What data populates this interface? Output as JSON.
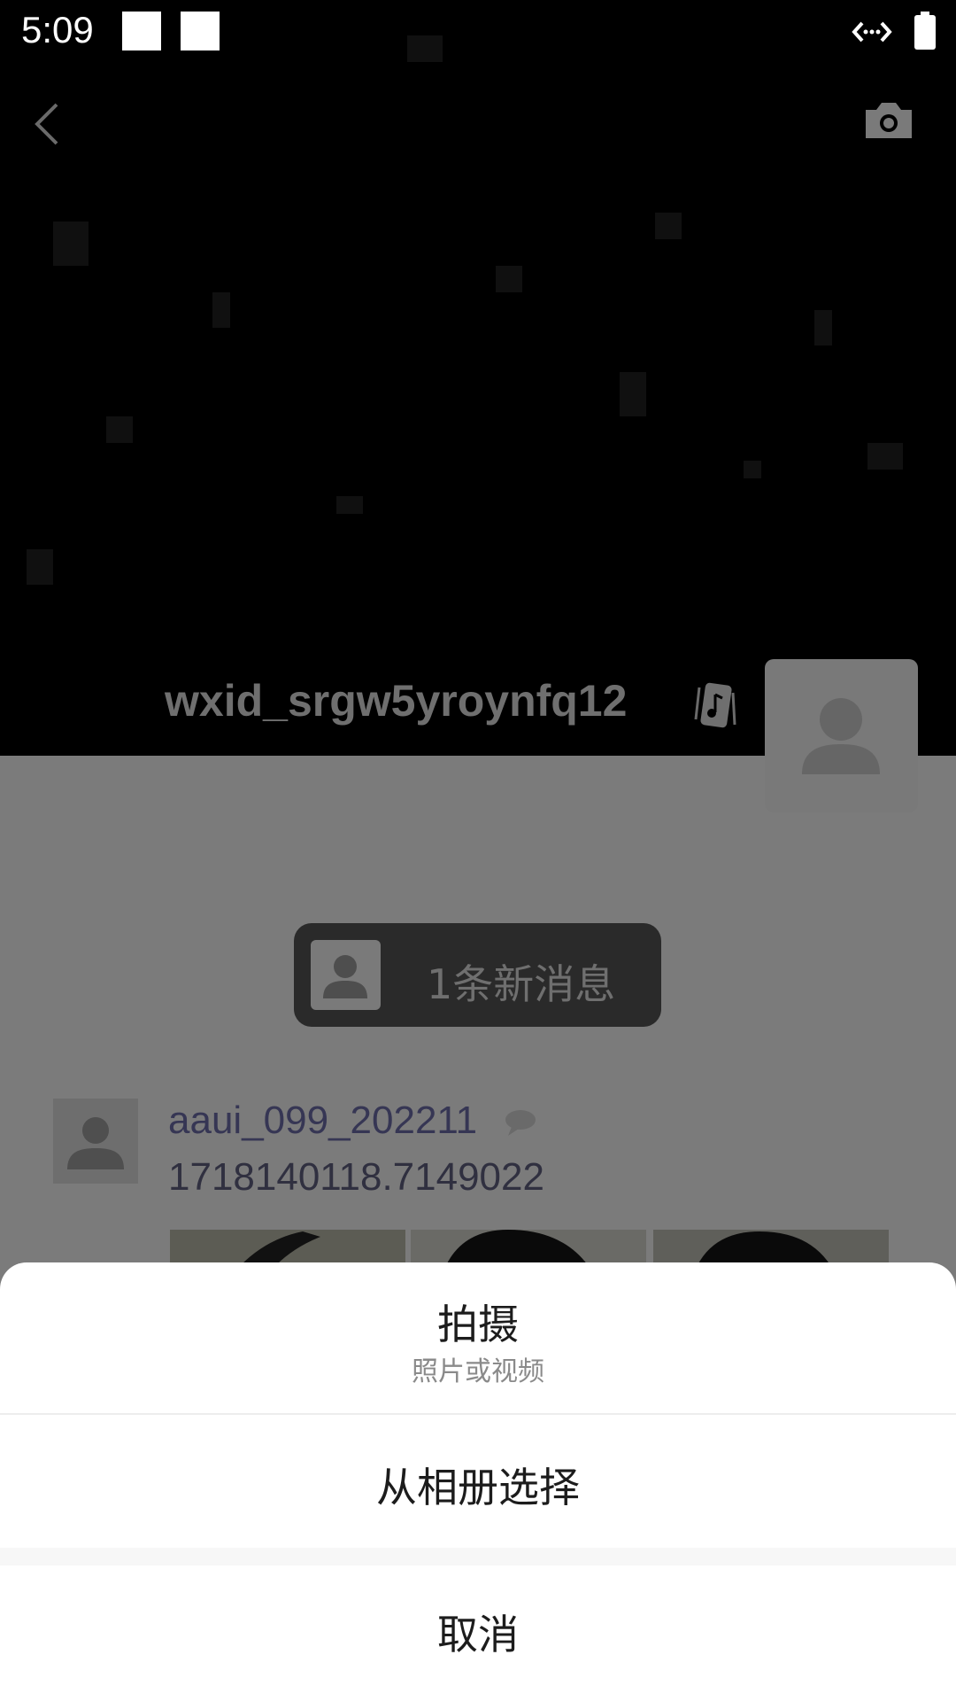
{
  "status_bar": {
    "time": "5:09",
    "icons": [
      "notification-square",
      "notification-square",
      "network-icon",
      "battery-icon"
    ]
  },
  "header": {
    "back_icon": "chevron-left-icon",
    "camera_icon": "camera-icon"
  },
  "cover": {
    "user_name": "wxid_srgw5yroynfq12",
    "status_icon": "music-note-icon"
  },
  "new_message_banner": {
    "text": "1条新消息"
  },
  "post": {
    "author": "aaui_099_202211",
    "text": "1718140118.7149022",
    "image_count_visible": 3
  },
  "action_sheet": {
    "shoot": {
      "title": "拍摄",
      "subtitle": "照片或视频"
    },
    "album": {
      "label": "从相册选择"
    },
    "cancel": {
      "label": "取消"
    }
  },
  "colors": {
    "overlay_gray": "#7b7b7b",
    "sheet_bg": "#ffffff",
    "link_name": "#363654"
  }
}
